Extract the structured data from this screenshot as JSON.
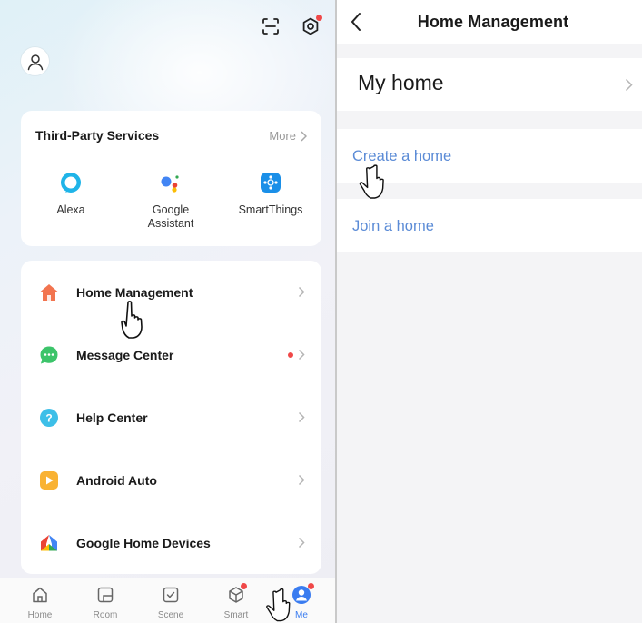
{
  "left": {
    "services": {
      "title": "Third-Party Services",
      "more_label": "More",
      "items": [
        {
          "line1": "Alexa",
          "line2": "",
          "icon": "alexa-icon",
          "color": "#1fb4e8"
        },
        {
          "line1": "Google",
          "line2": "Assistant",
          "icon": "google-assistant-icon",
          "color": "#4285f4"
        },
        {
          "line1": "SmartThings",
          "line2": "",
          "icon": "smartthings-icon",
          "color": "#1a8fe8"
        }
      ]
    },
    "menu": [
      {
        "label": "Home Management",
        "icon": "home-icon",
        "color": "#f2744f",
        "badge": false
      },
      {
        "label": "Message Center",
        "icon": "message-icon",
        "color": "#3cc46a",
        "badge": true
      },
      {
        "label": "Help Center",
        "icon": "help-icon",
        "color": "#3dbfe8",
        "badge": false
      },
      {
        "label": "Android Auto",
        "icon": "android-auto-icon",
        "color": "#f9b233",
        "badge": false
      },
      {
        "label": "Google Home Devices",
        "icon": "google-home-icon",
        "color": "#4285f4",
        "badge": false
      }
    ],
    "tabs": [
      {
        "label": "Home",
        "icon": "home-tab-icon",
        "active": false
      },
      {
        "label": "Room",
        "icon": "room-tab-icon",
        "active": false
      },
      {
        "label": "Scene",
        "icon": "scene-tab-icon",
        "active": false
      },
      {
        "label": "Smart",
        "icon": "smart-tab-icon",
        "active": false,
        "badge": true
      },
      {
        "label": "Me",
        "icon": "me-tab-icon",
        "active": true,
        "badge": true
      }
    ]
  },
  "right": {
    "title": "Home Management",
    "home_name": "My home",
    "create_label": "Create a home",
    "join_label": "Join a home"
  },
  "colors": {
    "accent": "#3a7cf0",
    "link": "#5b8bd6",
    "badge": "#f04848"
  }
}
